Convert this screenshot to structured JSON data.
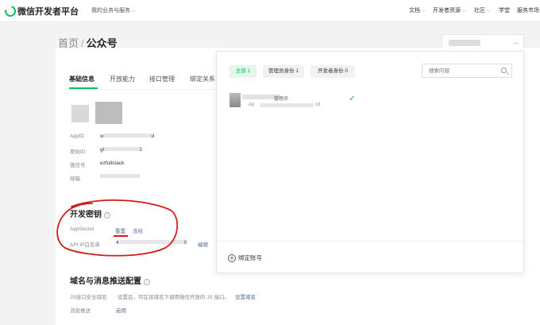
{
  "topnav": {
    "brand": "微信开发者平台",
    "biz_menu": "我的业务与服务",
    "items": [
      {
        "label": "文档",
        "chevron": true
      },
      {
        "label": "开发者资源",
        "chevron": true
      },
      {
        "label": "社区",
        "chevron": true
      },
      {
        "label": "学堂",
        "chevron": false
      },
      {
        "label": "服务市场",
        "chevron": false
      }
    ]
  },
  "breadcrumb": {
    "home": "首页",
    "separator": "/",
    "current": "公众号"
  },
  "tabs": [
    "基础信息",
    "开放能力",
    "接口管理",
    "绑定关系"
  ],
  "basic_info": {
    "fields": [
      {
        "label": "AppID",
        "value": "w",
        "suffix": "d"
      },
      {
        "label": "原始ID",
        "value": "gl",
        "suffix": "3"
      },
      {
        "label": "微信号",
        "value": "ezfullstack",
        "suffix": ""
      },
      {
        "label": "邮箱",
        "value": "",
        "suffix": ""
      }
    ]
  },
  "dev_key": {
    "title": "开发密钥",
    "appsecret_label": "AppSecret",
    "reset_label": "重置",
    "freeze_label": "冻结",
    "ip_label": "API IP白名单",
    "ip_value": "4",
    "ip_suffix": "0",
    "edit_label": "编辑"
  },
  "domain_section": {
    "title": "域名与消息推送配置",
    "js_label": "JS接口安全域名",
    "js_desc": "设置后，可在该域名下调用微信开放的 JS 接口。",
    "js_link": "设置域名",
    "push_label": "消息推送",
    "push_link": "启用"
  },
  "dropdown": {
    "filters": [
      {
        "label": "全部 1",
        "active": true
      },
      {
        "label": "管理员身份 1",
        "active": false
      },
      {
        "label": "开发者身份 0",
        "active": false
      }
    ],
    "search_placeholder": "搜索内容",
    "account": {
      "role": "管理员",
      "appid_prefix": "Ap",
      "appid_suffix": "cd"
    },
    "bind_label": "绑定账号"
  },
  "colors": {
    "accent": "#07c160",
    "link": "#576b95",
    "annotation": "#d21c1c"
  }
}
